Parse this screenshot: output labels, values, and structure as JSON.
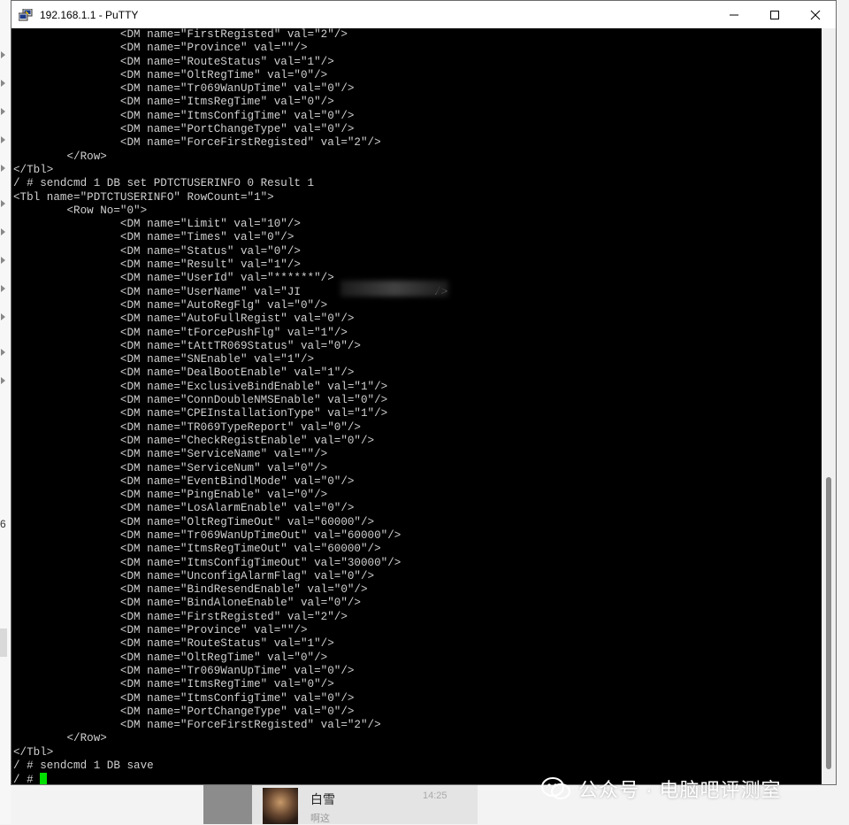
{
  "window": {
    "title": "192.168.1.1 - PuTTY"
  },
  "terminal": {
    "lines": [
      "                <DM name=\"FirstRegisted\" val=\"2\"/>",
      "                <DM name=\"Province\" val=\"\"/>",
      "                <DM name=\"RouteStatus\" val=\"1\"/>",
      "                <DM name=\"OltRegTime\" val=\"0\"/>",
      "                <DM name=\"Tr069WanUpTime\" val=\"0\"/>",
      "                <DM name=\"ItmsRegTime\" val=\"0\"/>",
      "                <DM name=\"ItmsConfigTime\" val=\"0\"/>",
      "                <DM name=\"PortChangeType\" val=\"0\"/>",
      "                <DM name=\"ForceFirstRegisted\" val=\"2\"/>",
      "        </Row>",
      "</Tbl>",
      "/ # sendcmd 1 DB set PDTCTUSERINFO 0 Result 1",
      "<Tbl name=\"PDTCTUSERINFO\" RowCount=\"1\">",
      "        <Row No=\"0\">",
      "                <DM name=\"Limit\" val=\"10\"/>",
      "                <DM name=\"Times\" val=\"0\"/>",
      "                <DM name=\"Status\" val=\"0\"/>",
      "                <DM name=\"Result\" val=\"1\"/>",
      "                <DM name=\"UserId\" val=\"******\"/>",
      "                <DM name=\"UserName\" val=\"JI                    />",
      "                <DM name=\"AutoRegFlg\" val=\"0\"/>",
      "                <DM name=\"AutoFullRegist\" val=\"0\"/>",
      "                <DM name=\"tForcePushFlg\" val=\"1\"/>",
      "                <DM name=\"tAttTR069Status\" val=\"0\"/>",
      "                <DM name=\"SNEnable\" val=\"1\"/>",
      "                <DM name=\"DealBootEnable\" val=\"1\"/>",
      "                <DM name=\"ExclusiveBindEnable\" val=\"1\"/>",
      "                <DM name=\"ConnDoubleNMSEnable\" val=\"0\"/>",
      "                <DM name=\"CPEInstallationType\" val=\"1\"/>",
      "                <DM name=\"TR069TypeReport\" val=\"0\"/>",
      "                <DM name=\"CheckRegistEnable\" val=\"0\"/>",
      "                <DM name=\"ServiceName\" val=\"\"/>",
      "                <DM name=\"ServiceNum\" val=\"0\"/>",
      "                <DM name=\"EventBindlMode\" val=\"0\"/>",
      "                <DM name=\"PingEnable\" val=\"0\"/>",
      "                <DM name=\"LosAlarmEnable\" val=\"0\"/>",
      "                <DM name=\"OltRegTimeOut\" val=\"60000\"/>",
      "                <DM name=\"Tr069WanUpTimeOut\" val=\"60000\"/>",
      "                <DM name=\"ItmsRegTimeOut\" val=\"60000\"/>",
      "                <DM name=\"ItmsConfigTimeOut\" val=\"30000\"/>",
      "                <DM name=\"UnconfigAlarmFlag\" val=\"0\"/>",
      "                <DM name=\"BindResendEnable\" val=\"0\"/>",
      "                <DM name=\"BindAloneEnable\" val=\"0\"/>",
      "                <DM name=\"FirstRegisted\" val=\"2\"/>",
      "                <DM name=\"Province\" val=\"\"/>",
      "                <DM name=\"RouteStatus\" val=\"1\"/>",
      "                <DM name=\"OltRegTime\" val=\"0\"/>",
      "                <DM name=\"Tr069WanUpTime\" val=\"0\"/>",
      "                <DM name=\"ItmsRegTime\" val=\"0\"/>",
      "                <DM name=\"ItmsConfigTime\" val=\"0\"/>",
      "                <DM name=\"PortChangeType\" val=\"0\"/>",
      "                <DM name=\"ForceFirstRegisted\" val=\"2\"/>",
      "        </Row>",
      "</Tbl>",
      "/ # sendcmd 1 DB save"
    ],
    "prompt": "/ # "
  },
  "background": {
    "left_edge_text": "6",
    "chat": {
      "name": "白雪",
      "time": "14:25",
      "preview": "啊这"
    },
    "watermark": "公众号 · 电脑吧评测室"
  },
  "colors": {
    "terminal_bg": "#000000",
    "terminal_fg": "#d0d0d0",
    "cursor": "#00e000"
  },
  "icons": {
    "app": "putty-icon",
    "minimize": "minimize-icon",
    "maximize": "maximize-icon",
    "close": "close-icon",
    "watermark": "wechat-icon"
  }
}
